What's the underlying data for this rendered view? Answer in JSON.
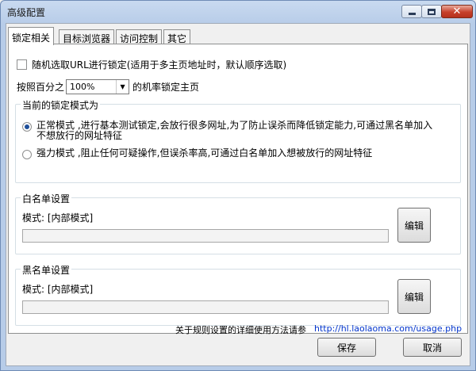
{
  "window": {
    "title": "高级配置",
    "controls": {
      "minimize": "−",
      "maximize": "□",
      "close": "✕"
    }
  },
  "tabs": [
    {
      "label": "锁定相关",
      "active": true
    },
    {
      "label": "目标浏览器",
      "active": false
    },
    {
      "label": "访问控制",
      "active": false
    },
    {
      "label": "其它",
      "active": false
    }
  ],
  "lock": {
    "random_label": "随机选取URL进行锁定(适用于多主页地址时，默认顺序选取)",
    "random_checked": false,
    "percent_prefix": "按照百分之",
    "percent_value": "100%",
    "percent_suffix": "的机率锁定主页"
  },
  "mode_group": {
    "title": "当前的锁定模式为",
    "options": [
      {
        "label": "正常模式 ,进行基本测试锁定,会放行很多网址,为了防止误杀而降低锁定能力,可通过黑名单加入不想放行的网址特征",
        "selected": true
      },
      {
        "label": "强力模式 ,阻止任何可疑操作,但误杀率高,可通过白名单加入想被放行的网址特征",
        "selected": false
      }
    ]
  },
  "whitelist": {
    "title": "白名单设置",
    "mode_label": "模式: [内部模式]",
    "value": "",
    "edit_label": "编辑"
  },
  "blacklist": {
    "title": "黑名单设置",
    "mode_label": "模式: [内部模式]",
    "value": "",
    "edit_label": "编辑"
  },
  "help": {
    "text": "关于规则设置的详细使用方法请参",
    "link": "http://hl.laolaoma.com/usage.php"
  },
  "footer": {
    "save_label": "保存",
    "cancel_label": "取消"
  }
}
